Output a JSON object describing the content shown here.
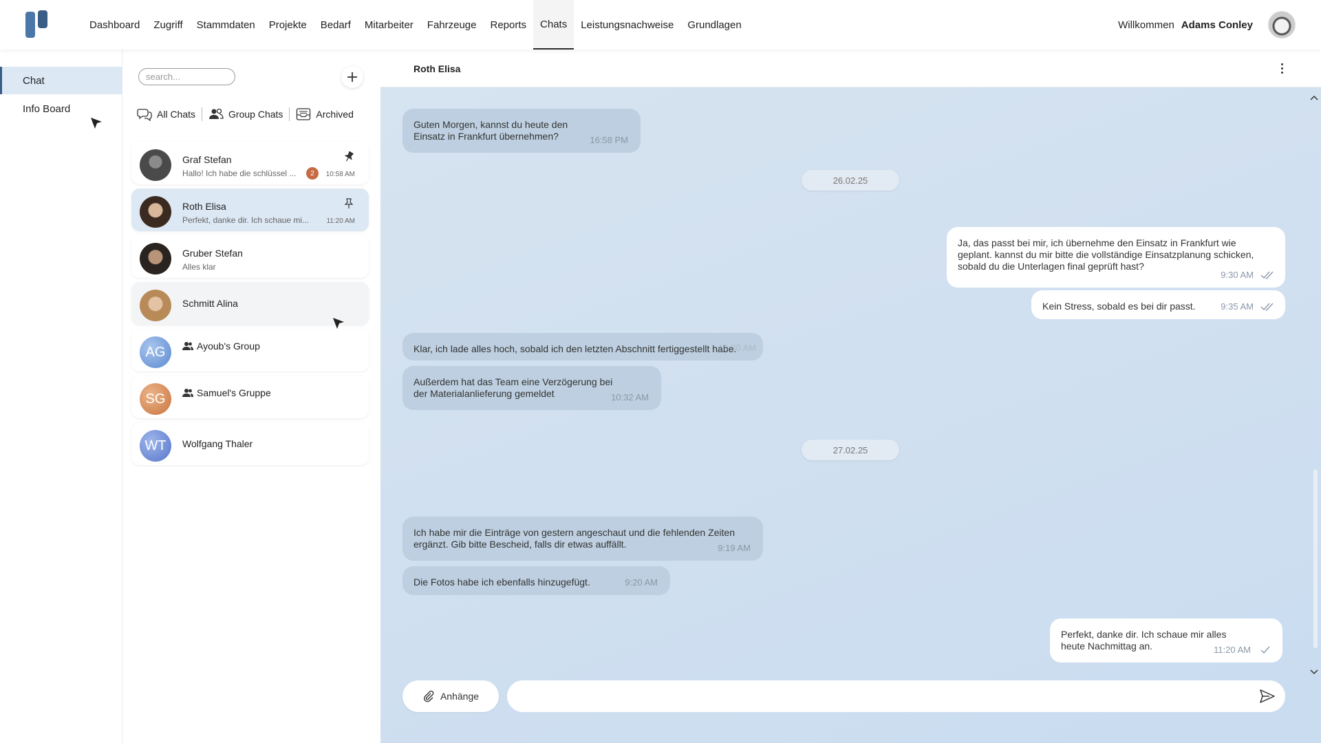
{
  "nav": {
    "items": [
      "Dashboard",
      "Zugriff",
      "Stammdaten",
      "Projekte",
      "Bedarf",
      "Mitarbeiter",
      "Fahrzeuge",
      "Reports",
      "Chats",
      "Leistungsnachweise",
      "Grundlagen"
    ],
    "active": "Chats",
    "welcome": "Willkommen",
    "user_name": "Adams Conley"
  },
  "sidebar": {
    "items": [
      {
        "label": "Chat",
        "active": true
      },
      {
        "label": "Info Board",
        "active": false
      }
    ]
  },
  "chat_list": {
    "search_placeholder": "search...",
    "filters": [
      "All Chats",
      "Group Chats",
      "Archived"
    ],
    "chats": [
      {
        "name": "Graf Stefan",
        "preview": "Hallo! Ich habe die schlüssel ...",
        "time": "10:58 AM",
        "unread": "2",
        "pinned": true,
        "avatar": "photo"
      },
      {
        "name": "Roth Elisa",
        "preview": "Perfekt, danke dir. Ich schaue mi...",
        "time": "11:20 AM",
        "pinned": true,
        "active": true,
        "avatar": "photo"
      },
      {
        "name": "Gruber Stefan",
        "preview": "Alles klar",
        "avatar": "photo"
      },
      {
        "name": "Schmitt Alina",
        "avatar": "photo"
      },
      {
        "name": "Ayoub's Group",
        "initials": "AG",
        "group": true,
        "color": "#6f9bd6"
      },
      {
        "name": "Samuel's Gruppe",
        "initials": "SG",
        "group": true,
        "color": "#d98a52"
      },
      {
        "name": "Wolfgang Thaler",
        "initials": "WT",
        "color": "#6d8ed8"
      }
    ]
  },
  "conversation": {
    "title": "Roth Elisa",
    "messages": [
      {
        "dir": "in",
        "text": "Guten Morgen, kannst du heute den Einsatz in Frankfurt übernehmen?",
        "time": "16:58  PM"
      },
      {
        "date": "26.02.25"
      },
      {
        "dir": "out",
        "text": "Ja, das passt bei mir, ich übernehme den Einsatz in Frankfurt wie geplant. kannst du mir bitte die vollständige Einsatzplanung schicken, sobald du die Unterlagen final geprüft hast?",
        "time": "9:30  AM"
      },
      {
        "dir": "out",
        "text": "Kein Stress, sobald es bei dir passt.",
        "time": "9:35  AM"
      },
      {
        "dir": "in",
        "text": "Klar, ich lade alles hoch, sobald ich den letzten Abschnitt fertiggestellt habe.",
        "time": "10:30  AM"
      },
      {
        "dir": "in",
        "text": "Außerdem hat das Team eine Verzögerung bei der Materialanlieferung gemeldet",
        "time": "10:32  AM"
      },
      {
        "date": "27.02.25"
      },
      {
        "dir": "in",
        "text": "Ich habe mir die Einträge von gestern angeschaut und die fehlenden Zeiten ergänzt. Gib bitte Bescheid, falls dir etwas auffällt.",
        "time": "9:19  AM"
      },
      {
        "dir": "in",
        "text": "Die Fotos habe ich ebenfalls hinzugefügt.",
        "time": "9:20  AM"
      },
      {
        "dir": "out",
        "text": "Perfekt, danke dir. Ich schaue mir alles heute Nachmittag an.",
        "time": "11:20  AM"
      }
    ],
    "attach_label": "Anhänge",
    "input_value": ""
  },
  "colors": {
    "accent": "#3a5d85",
    "active_bg": "#dce8f4",
    "conv_bg": "#d0e0f0",
    "incoming_bubble": "#bdcfe0",
    "outgoing_bubble": "#ffffff",
    "unread_badge": "#c66a44"
  },
  "icons": [
    "logo",
    "plus-icon",
    "chat-bubbles-icon",
    "group-icon",
    "archive-icon",
    "pin-icon",
    "kebab-icon",
    "paperclip-icon",
    "send-icon",
    "check-icon",
    "chevron-up-icon",
    "chevron-down-icon"
  ]
}
